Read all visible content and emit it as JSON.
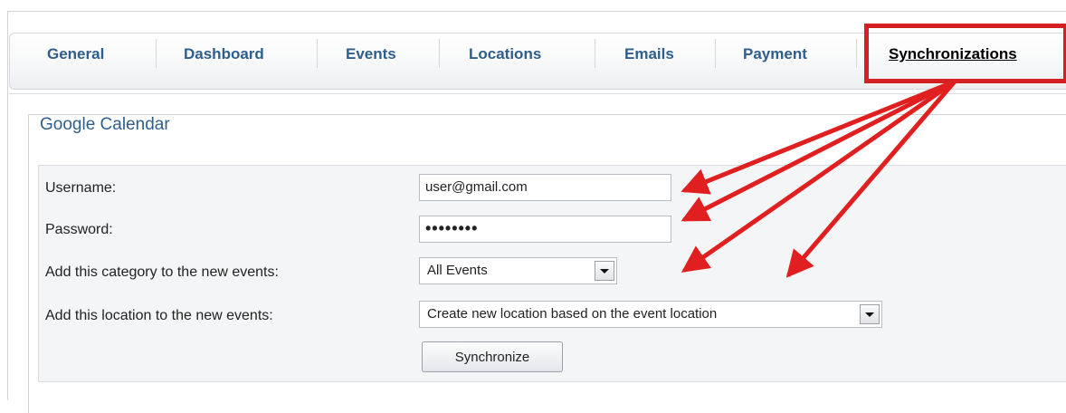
{
  "tabs": [
    {
      "label": "General"
    },
    {
      "label": "Dashboard"
    },
    {
      "label": "Events"
    },
    {
      "label": "Locations"
    },
    {
      "label": "Emails"
    },
    {
      "label": "Payment"
    },
    {
      "label": "Synchronizations",
      "active": true
    }
  ],
  "section": {
    "legend": "Google Calendar"
  },
  "form": {
    "username": {
      "label": "Username:",
      "value": "user@gmail.com"
    },
    "password": {
      "label": "Password:",
      "value": "••••••••"
    },
    "category": {
      "label": "Add this category to the new events:",
      "selected": "All Events"
    },
    "location": {
      "label": "Add this location to the new events:",
      "selected": "Create new location based on the event location"
    },
    "submit_label": "Synchronize"
  },
  "colors": {
    "tab_text": "#2f5e8c",
    "highlight": "#d42020",
    "panel_bg": "#f4f5f6"
  },
  "icons": {
    "dropdown": "chevron-down-icon",
    "annotation": "arrow-icon"
  }
}
